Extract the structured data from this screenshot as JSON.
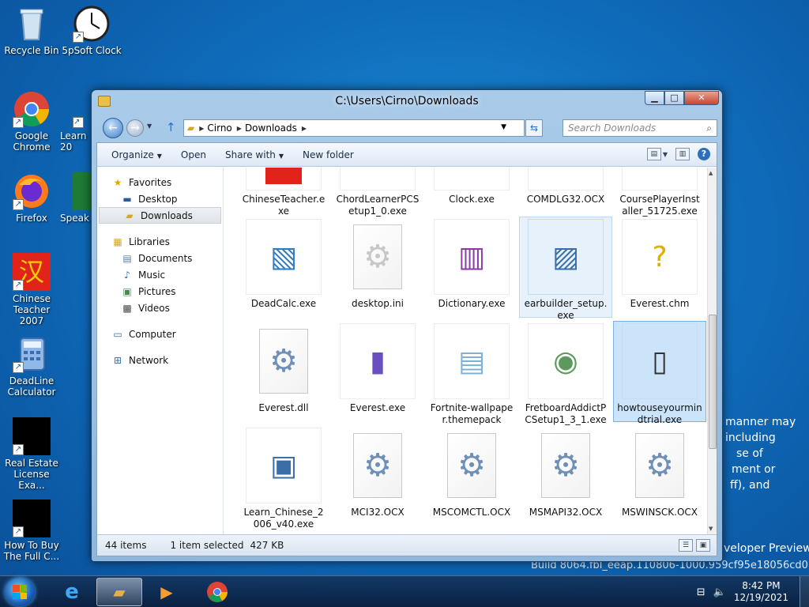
{
  "desktop": {
    "icons": [
      {
        "label": "Recycle Bin"
      },
      {
        "label": "5pSoft Clock"
      },
      {
        "label": "Google Chrome"
      },
      {
        "label": "Learn 20"
      },
      {
        "label": "Firefox"
      },
      {
        "label": "Speak"
      },
      {
        "label": "Chinese Teacher 2007"
      },
      {
        "label": "DeadLine Calculator"
      },
      {
        "label": "Real Estate License Exa..."
      },
      {
        "label": "How To Buy The Full C..."
      }
    ],
    "bg_text": [
      "manner may",
      "including",
      "se of",
      "ment or",
      "ff), and"
    ],
    "preview_text": "veloper Preview",
    "build_text": "Build 8064.fbl_eeap.110806-1000.959cf95e18056cd0"
  },
  "window": {
    "title": "C:\\Users\\Cirno\\Downloads",
    "address": {
      "segments": [
        "Cirno",
        "Downloads"
      ]
    },
    "search_placeholder": "Search Downloads",
    "toolbar": {
      "organize": "Organize",
      "open": "Open",
      "share_with": "Share with",
      "new_folder": "New folder"
    },
    "nav": {
      "favorites": "Favorites",
      "desktop": "Desktop",
      "downloads": "Downloads",
      "libraries": "Libraries",
      "documents": "Documents",
      "music": "Music",
      "pictures": "Pictures",
      "videos": "Videos",
      "computer": "Computer",
      "network": "Network"
    },
    "files": [
      {
        "name": "ChineseTeacher.exe"
      },
      {
        "name": "ChordLearnerPCSetup1_0.exe"
      },
      {
        "name": "Clock.exe"
      },
      {
        "name": "COMDLG32.OCX"
      },
      {
        "name": "CoursePlayerInstaller_51725.exe"
      },
      {
        "name": "DeadCalc.exe"
      },
      {
        "name": "desktop.ini"
      },
      {
        "name": "Dictionary.exe"
      },
      {
        "name": "earbuilder_setup.exe"
      },
      {
        "name": "Everest.chm"
      },
      {
        "name": "Everest.dll"
      },
      {
        "name": "Everest.exe"
      },
      {
        "name": "Fortnite-wallpaper.themepack"
      },
      {
        "name": "FretboardAddictPCSetup1_3_1.exe"
      },
      {
        "name": "howtouseyourmindtrial.exe"
      },
      {
        "name": "Learn_Chinese_2006_v40.exe"
      },
      {
        "name": "MCI32.OCX"
      },
      {
        "name": "MSCOMCTL.OCX"
      },
      {
        "name": "MSMAPI32.OCX"
      },
      {
        "name": "MSWINSCK.OCX"
      }
    ],
    "status": {
      "count": "44 items",
      "selected": "1 item selected",
      "size": "427 KB"
    }
  },
  "taskbar": {
    "time": "8:42 PM",
    "date": "12/19/2021"
  }
}
